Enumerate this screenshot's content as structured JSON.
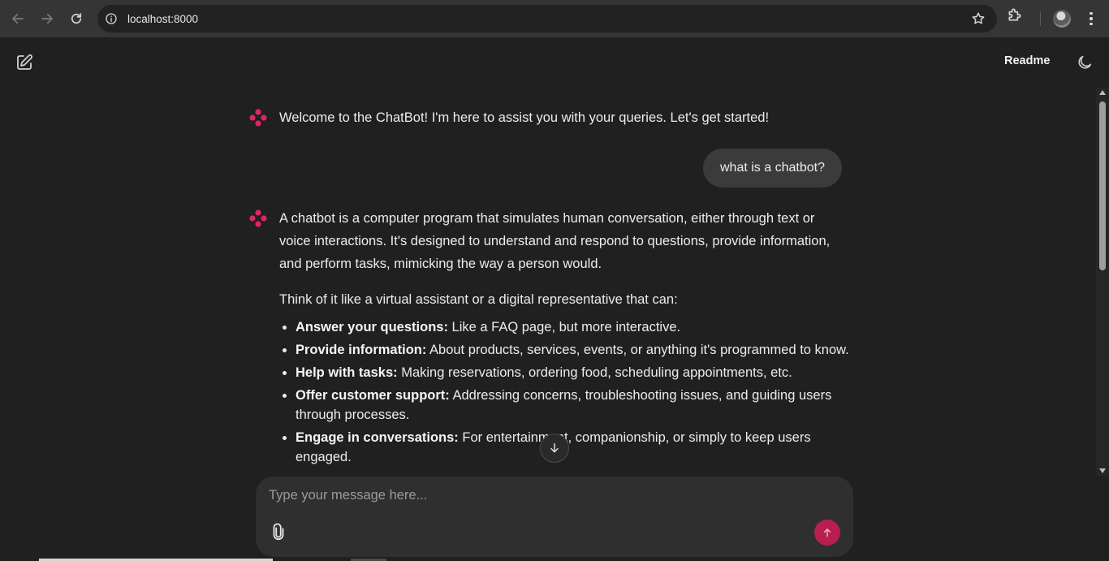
{
  "browser": {
    "url": "localhost:8000"
  },
  "header": {
    "readme_label": "Readme"
  },
  "messages": {
    "welcome": "Welcome to the ChatBot! I'm here to assist you with your queries. Let's get started!",
    "user_question": "what is a chatbot?",
    "answer_p1": "A chatbot is a computer program that simulates human conversation, either through text or voice interactions. It's designed to understand and respond to questions, provide information, and perform tasks, mimicking the way a person would.",
    "answer_p2": "Think of it like a virtual assistant or a digital representative that can:",
    "bullets": [
      {
        "title": "Answer your questions:",
        "text": " Like a FAQ page, but more interactive."
      },
      {
        "title": "Provide information:",
        "text": " About products, services, events, or anything it's programmed to know."
      },
      {
        "title": "Help with tasks:",
        "text": " Making reservations, ordering food, scheduling appointments, etc."
      },
      {
        "title": "Offer customer support:",
        "text": " Addressing concerns, troubleshooting issues, and guiding users through processes."
      },
      {
        "title": "Engage in conversations:",
        "text": " For entertainment, companionship, or simply to keep users engaged."
      }
    ]
  },
  "composer": {
    "placeholder": "Type your message here..."
  },
  "colors": {
    "accent": "#e0246a",
    "send_button": "#b81e4f",
    "background": "#202020",
    "user_bubble": "#3b3b3b"
  },
  "icons": {
    "back": "arrow-left-icon",
    "forward": "arrow-right-icon",
    "reload": "reload-icon",
    "site_info": "info-icon",
    "bookmark": "star-icon",
    "extensions": "puzzle-icon",
    "menu": "kebab-menu-icon",
    "new_chat": "edit-icon",
    "theme": "moon-icon",
    "bot": "bot-logo-icon",
    "attach": "paperclip-icon",
    "send": "arrow-up-icon",
    "scroll": "arrow-down-icon"
  }
}
